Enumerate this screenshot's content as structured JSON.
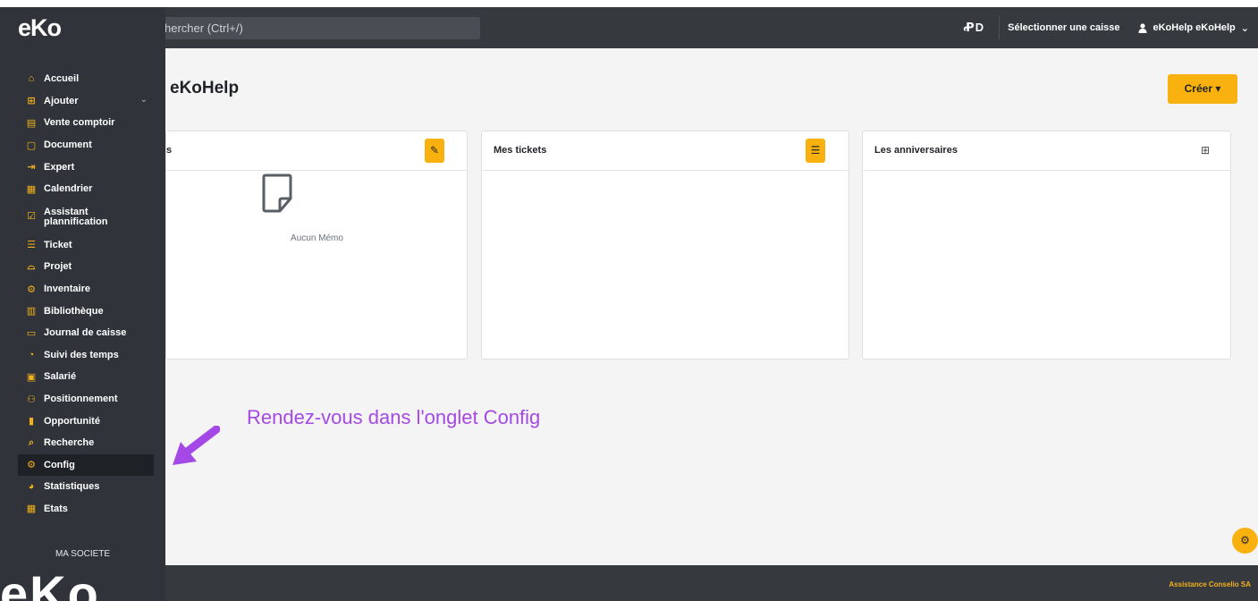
{
  "header": {
    "search_placeholder": "hercher (Ctrl+/)",
    "layout_icon": "ꝒD",
    "select_register": "Sélectionner une caisse",
    "user_name": "eKoHelp eKoHelp",
    "user_chevron": "⌄"
  },
  "sidebar": {
    "logo": "eKo",
    "items": [
      {
        "label": "Accueil",
        "icon": "⌂"
      },
      {
        "label": "Ajouter",
        "icon": "⊞"
      },
      {
        "label": "Vente comptoir",
        "icon": "▤"
      },
      {
        "label": "Document",
        "icon": "▢"
      },
      {
        "label": "Expert",
        "icon": "⇥"
      },
      {
        "label": "Calendrier",
        "icon": "▦"
      },
      {
        "label": "Assistant plannification",
        "icon": "☑"
      },
      {
        "label": "Ticket",
        "icon": "☰"
      },
      {
        "label": "Projet",
        "icon": "⌓"
      },
      {
        "label": "Inventaire",
        "icon": "⚙"
      },
      {
        "label": "Bibliothèque",
        "icon": "▥"
      },
      {
        "label": "Journal de caisse",
        "icon": "▭"
      },
      {
        "label": "Suivi des temps",
        "icon": "◔"
      },
      {
        "label": "Salarié",
        "icon": "▣"
      },
      {
        "label": "Positionnement",
        "icon": "⚇"
      },
      {
        "label": "Opportunité",
        "icon": "▮"
      },
      {
        "label": "Recherche",
        "icon": "⌕"
      },
      {
        "label": "Config",
        "icon": "⚙"
      },
      {
        "label": "Statistiques",
        "icon": "◕"
      },
      {
        "label": "Etats",
        "icon": "▦"
      }
    ],
    "ajouter_chevron": "⌄",
    "company": "MA SOCIETE",
    "big_logo": "eKo"
  },
  "main": {
    "page_title": "eKoHelp",
    "create_button": "Créer ▾",
    "cards": [
      {
        "title": "s",
        "button_icon": "✎",
        "empty_text": "Aucun Mémo"
      },
      {
        "title": "Mes tickets",
        "button_icon": "☰"
      },
      {
        "title": "Les anniversaires",
        "button_icon": "⊞"
      }
    ],
    "annotation": "Rendez-vous dans l'onglet Config",
    "fab_icon": "⚙"
  },
  "footer": {
    "text": "Assistance Conselio SA"
  },
  "colors": {
    "accent": "#f8b10f",
    "sidebar_bg": "#30343a",
    "topbar_bg": "#363a3f",
    "annotation": "#a449e6"
  }
}
